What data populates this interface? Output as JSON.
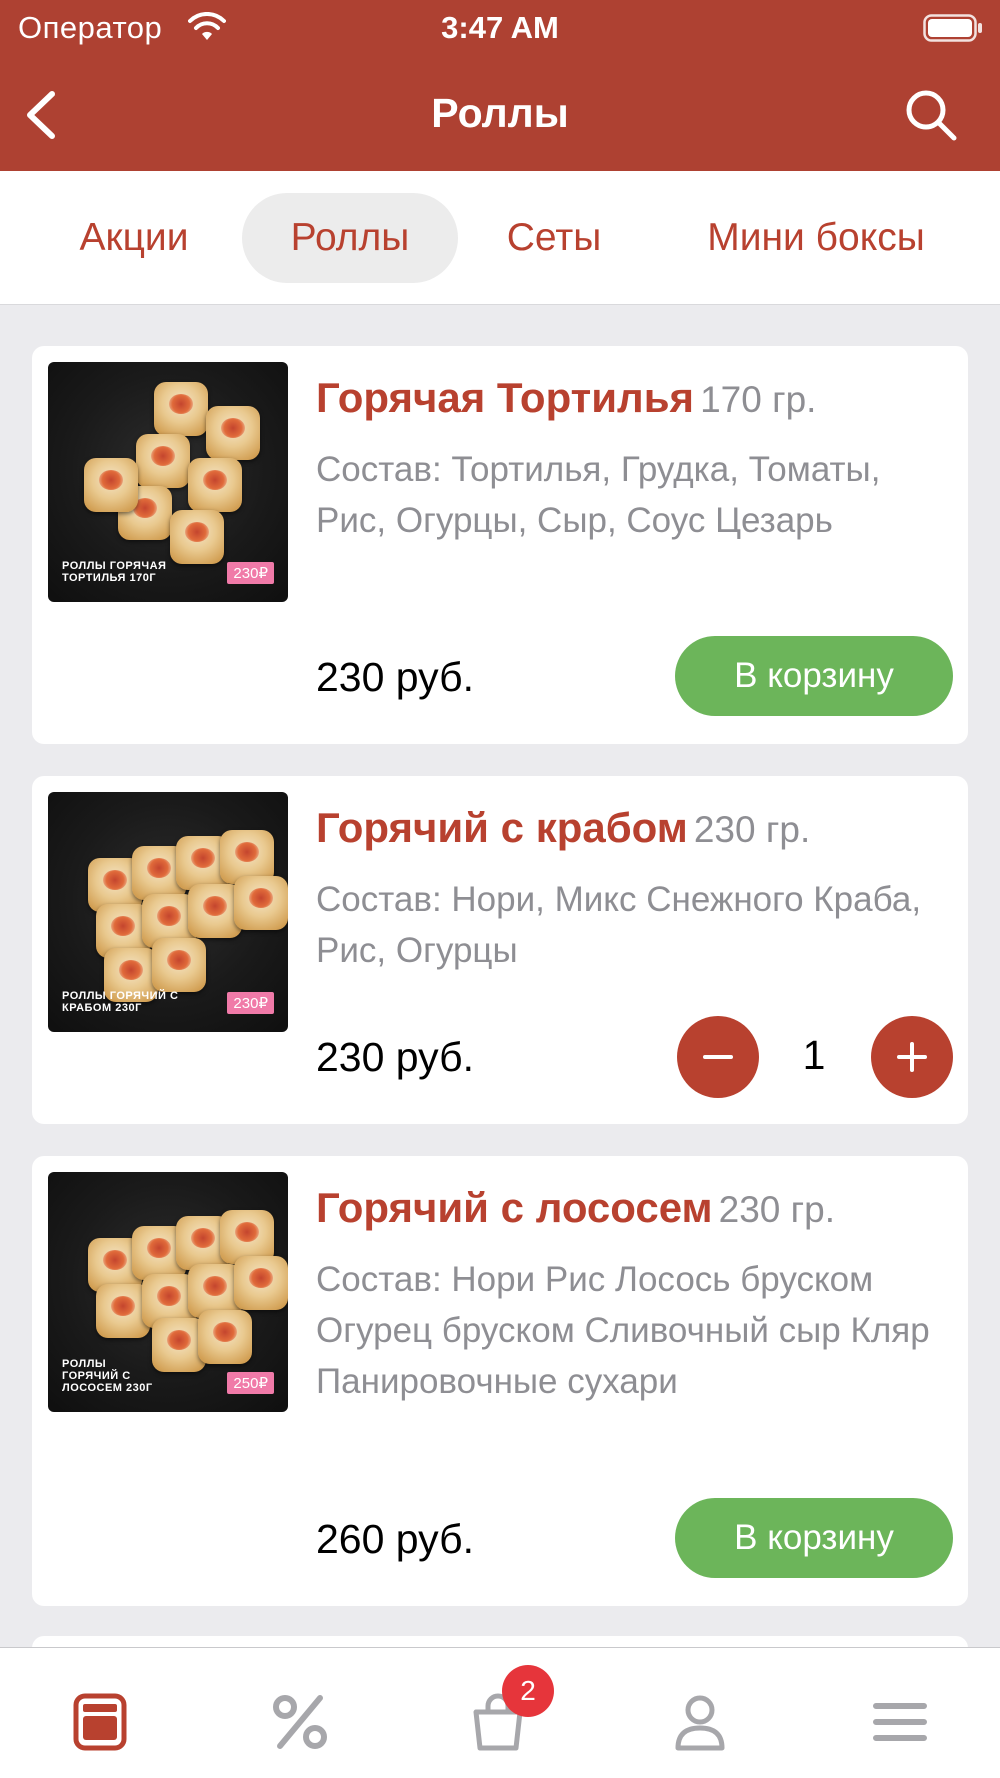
{
  "status_bar": {
    "carrier": "Оператор",
    "time": "3:47 AM"
  },
  "nav": {
    "title": "Роллы"
  },
  "categories": [
    {
      "label": "Акции",
      "active": false
    },
    {
      "label": "Роллы",
      "active": true
    },
    {
      "label": "Сеты",
      "active": false
    },
    {
      "label": "Мини боксы",
      "active": false
    }
  ],
  "products": [
    {
      "name": "Горячая Тортилья",
      "weight": "170 гр.",
      "description": "Состав: Тортилья, Грудка, Томаты, Рис, Огурцы, Сыр, Соус Цезарь",
      "price": "230 руб.",
      "image_caption": "роллы ГОРЯЧАЯ ТОРТИЛЬЯ 170г",
      "image_price": "230₽",
      "in_cart": false,
      "cart_label": "В корзину"
    },
    {
      "name": "Горячий с крабом",
      "weight": "230 гр.",
      "description": "Состав: Нори, Микс Снежного Краба, Рис, Огурцы",
      "price": "230 руб.",
      "image_caption": "роллы ГОРЯЧИЙ С КРАБОМ 230г",
      "image_price": "230₽",
      "in_cart": true,
      "quantity": "1"
    },
    {
      "name": "Горячий с лососем",
      "weight": "230 гр.",
      "description": "Состав: Нори Рис Лосось бруском Огурец бруском Сливочный сыр Кляр Панировочные сухари",
      "price": "260 руб.",
      "image_caption": "роллы ГОРЯЧИЙ С ЛОСОСЕМ 230г",
      "image_price": "250₽",
      "in_cart": false,
      "cart_label": "В корзину"
    }
  ],
  "tabbar": {
    "items": [
      {
        "icon": "menu-icon",
        "active": true
      },
      {
        "icon": "percent-icon",
        "active": false
      },
      {
        "icon": "cart-icon",
        "active": false
      },
      {
        "icon": "profile-icon",
        "active": false
      },
      {
        "icon": "hamburger-icon",
        "active": false
      }
    ],
    "cart_badge": "2"
  },
  "colors": {
    "brand": "#ae4132",
    "accent_text": "#b8412f",
    "cart_button": "#6cb55a",
    "badge": "#e6353b",
    "inactive_icon": "#a7a7ab"
  }
}
